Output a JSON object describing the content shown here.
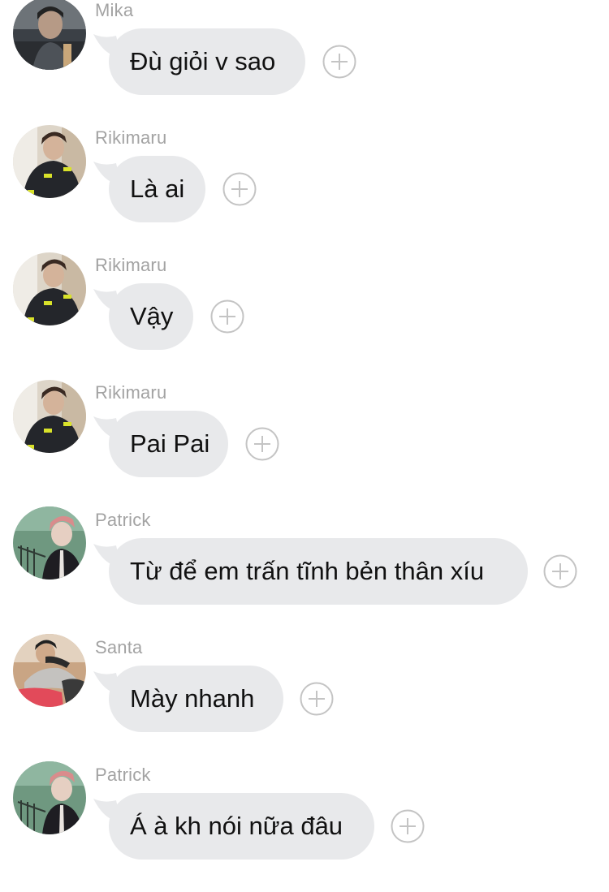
{
  "colors": {
    "background": "#ffffff",
    "bubble": "#e8e9eb",
    "sender_name": "#a3a3a3",
    "message_text": "#111111",
    "react_icon": "#c4c4c4"
  },
  "messages": [
    {
      "sender": "Mika",
      "text": "Đù giỏi v sao",
      "avatar": "mika-avatar"
    },
    {
      "sender": "Rikimaru",
      "text": "Là ai",
      "avatar": "rikimaru-avatar"
    },
    {
      "sender": "Rikimaru",
      "text": "Vậy",
      "avatar": "rikimaru-avatar"
    },
    {
      "sender": "Rikimaru",
      "text": "Pai Pai",
      "avatar": "rikimaru-avatar"
    },
    {
      "sender": "Patrick",
      "text": "Từ để em trấn tĩnh bẻn thân xíu",
      "avatar": "patrick-avatar"
    },
    {
      "sender": "Santa",
      "text": "Mày nhanh",
      "avatar": "santa-avatar"
    },
    {
      "sender": "Patrick",
      "text": "Á à kh nói nữa đâu",
      "avatar": "patrick-avatar"
    }
  ],
  "react_icon": "add-reaction-icon"
}
